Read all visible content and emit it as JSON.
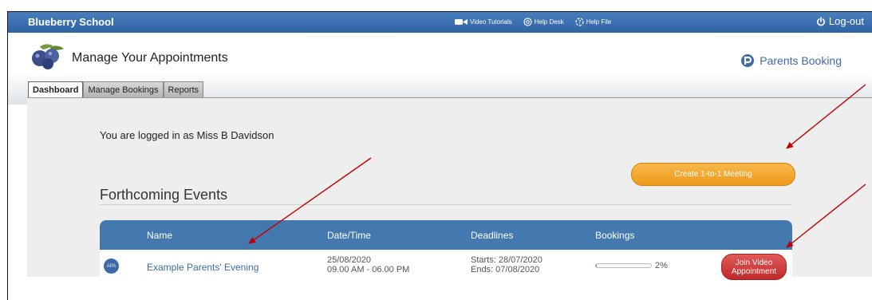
{
  "topbar": {
    "school": "Blueberry School",
    "links": [
      {
        "label": "Video Tutorials",
        "icon": "video-camera-icon"
      },
      {
        "label": "Help Desk",
        "icon": "lifebuoy-icon"
      },
      {
        "label": "Help File",
        "icon": "help-file-icon"
      }
    ],
    "logout": "Log-out"
  },
  "header": {
    "title": "Manage Your Appointments",
    "brand": "Parents Booking",
    "tabs": [
      "Dashboard",
      "Manage Bookings",
      "Reports"
    ]
  },
  "dashboard": {
    "logged_in": "You are logged in as Miss B Davidson",
    "create_button": "Create 1-to-1 Meeting",
    "events_title": "Forthcoming Events",
    "columns": [
      "Name",
      "Date/Time",
      "Deadlines",
      "Bookings"
    ],
    "events": [
      {
        "avatar": "APA",
        "name": "Example Parents' Evening",
        "date": "25/08/2020",
        "time": "09.00 AM - 06.00 PM",
        "starts": "Starts: 28/07/2020",
        "ends": "Ends: 07/08/2020",
        "bookings_pct": "2%",
        "bookings_fraction": 0.02,
        "join_line1": "Join Video",
        "join_line2": "Appointment"
      }
    ]
  },
  "colors": {
    "topbar": "#2f63a3",
    "accent": "#4479b0",
    "orange": "#f0981c",
    "red": "#c02a2a",
    "annotation": "#c00000"
  }
}
